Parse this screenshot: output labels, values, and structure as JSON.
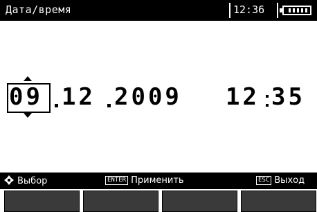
{
  "titlebar": {
    "title": "Дата/время",
    "clock": "12:36",
    "battery_level": 0.75
  },
  "datetime": {
    "day": "09",
    "month": "12",
    "year": "2009",
    "hours": "12",
    "minutes": "35",
    "selected_field": "day"
  },
  "hints": {
    "select_label": "Выбор",
    "enter_key": "ENTER",
    "apply_label": "Применить",
    "esc_key": "ESC",
    "exit_label": "Выход"
  },
  "softkeys": [
    "",
    "",
    "",
    ""
  ]
}
